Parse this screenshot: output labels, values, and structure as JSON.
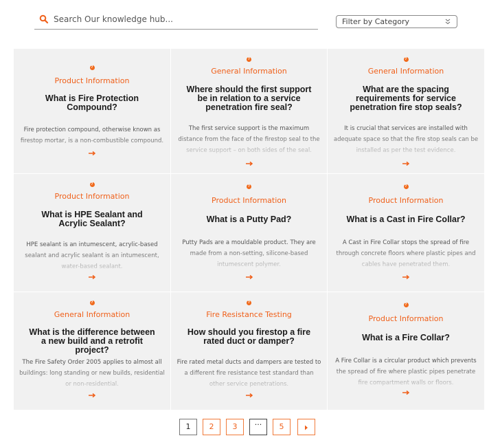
{
  "search": {
    "placeholder": "Search Our knowledge hub...",
    "value": ""
  },
  "filter": {
    "selected": "Filter by Category"
  },
  "cards": [
    {
      "category": "Product Information",
      "title": "What is Fire Protection Compound?",
      "excerpt": "Fire protection compound, otherwise known as firestop mortar, is a non-combustible compound."
    },
    {
      "category": "General Information",
      "title": "Where should the first support be in relation to a service penetration fire seal?",
      "excerpt": "The first service support is the maximum distance from the face of the firestop seal to the service support – on both sides of the seal."
    },
    {
      "category": "General Information",
      "title": "What are the spacing requirements for service penetration fire stop seals?",
      "excerpt": "It is crucial that services are installed with adequate space so that the fire stop seals can be installed as per the test evidence."
    },
    {
      "category": "Product Information",
      "title": "What is HPE Sealant and Acrylic Sealant?",
      "excerpt": "HPE sealant is an intumescent, acrylic-based sealant and acrylic sealant is an intumescent, water-based sealant."
    },
    {
      "category": "Product Information",
      "title": "What is a Putty Pad?",
      "excerpt": "Putty Pads are a mouldable product. They are made from a non-setting, silicone-based intumescent polymer."
    },
    {
      "category": "Product Information",
      "title": "What is a Cast in Fire Collar?",
      "excerpt": "A Cast in Fire Collar stops the spread of fire through concrete floors where plastic pipes and cables have penetrated them."
    },
    {
      "category": "General Information",
      "title": "What is the difference between a new build and a retrofit project?",
      "excerpt": "The Fire Safety Order 2005 applies to almost all buildings: long standing or new builds, residential or non-residential."
    },
    {
      "category": "Fire Resistance Testing",
      "title": "How should you firestop a fire rated duct or damper?",
      "excerpt": "Fire rated metal ducts and dampers are tested to a different fire resistance test standard than other service penetrations."
    },
    {
      "category": "Product Information",
      "title": "What is a Fire Collar?",
      "excerpt": "A Fire Collar is a circular product which prevents the spread of fire where plastic pipes penetrate fire compartment walls or floors."
    }
  ],
  "pagination": {
    "pages": [
      "1",
      "2",
      "3",
      "···",
      "5"
    ],
    "current": "1",
    "next_icon": "caret-right-icon"
  },
  "colors": {
    "accent": "#f0601a",
    "card_bg": "#f1f1f1",
    "title": "#1b1b1b"
  }
}
